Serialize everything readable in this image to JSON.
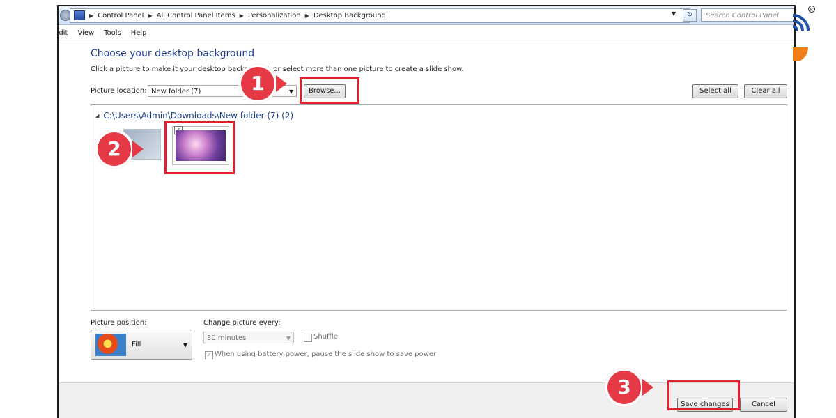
{
  "address": {
    "crumbs": [
      "Control Panel",
      "All Control Panel Items",
      "Personalization",
      "Desktop Background"
    ],
    "search_placeholder": "Search Control Panel"
  },
  "menu": [
    "Edit",
    "View",
    "Tools",
    "Help"
  ],
  "main": {
    "title": "Choose your desktop background",
    "description": "Click a picture to make it your desktop background, or select more than one picture to create a slide show.",
    "picture_location_label": "Picture location:",
    "picture_location_value": "New folder (7)",
    "browse_label": "Browse...",
    "select_all_label": "Select all",
    "clear_all_label": "Clear all",
    "folder_path": "C:\\Users\\Admin\\Downloads\\New folder (7) (2)",
    "picture_position_label": "Picture position:",
    "picture_position_value": "Fill",
    "change_every_label": "Change picture every:",
    "interval_value": "30 minutes",
    "shuffle_label": "Shuffle",
    "battery_label": "When using battery power, pause the slide show to save power"
  },
  "footer": {
    "save_label": "Save changes",
    "cancel_label": "Cancel"
  },
  "markers": {
    "step1": "1",
    "step2": "2",
    "step3": "3"
  },
  "colors": {
    "marker": "#e63946",
    "highlight": "#e3202e",
    "title_blue": "#1e3f8b"
  }
}
